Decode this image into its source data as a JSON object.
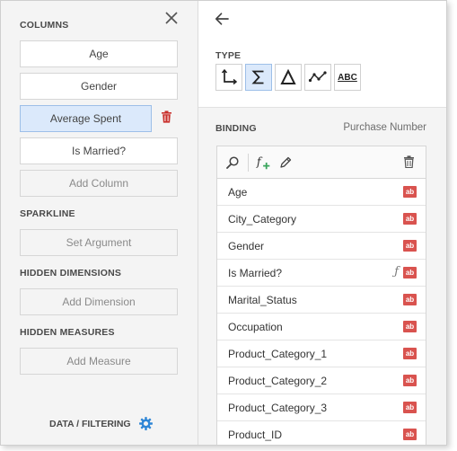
{
  "left": {
    "columns": {
      "title": "COLUMNS",
      "items": [
        {
          "label": "Age"
        },
        {
          "label": "Gender"
        },
        {
          "label": "Average Spent"
        },
        {
          "label": "Is Married?"
        }
      ],
      "add_label": "Add Column"
    },
    "sparkline": {
      "title": "SPARKLINE",
      "button": "Set Argument"
    },
    "hidden_dimensions": {
      "title": "HIDDEN DIMENSIONS",
      "button": "Add Dimension"
    },
    "hidden_measures": {
      "title": "HIDDEN MEASURES",
      "button": "Add Measure"
    },
    "data_filtering": "DATA / FILTERING"
  },
  "right": {
    "type_title": "TYPE",
    "type_buttons": [
      "dimension",
      "measure",
      "delta",
      "sparkline",
      "text"
    ],
    "type_selected": "measure",
    "type_text_glyph": "ABC",
    "binding_title": "BINDING",
    "binding_value": "Purchase Number",
    "fields": [
      {
        "name": "Age",
        "badge": "ab"
      },
      {
        "name": "City_Category",
        "badge": "ab"
      },
      {
        "name": "Gender",
        "badge": "ab"
      },
      {
        "name": "Is Married?",
        "badge": "ab",
        "calculated": true
      },
      {
        "name": "Marital_Status",
        "badge": "ab"
      },
      {
        "name": "Occupation",
        "badge": "ab"
      },
      {
        "name": "Product_Category_1",
        "badge": "ab"
      },
      {
        "name": "Product_Category_2",
        "badge": "ab"
      },
      {
        "name": "Product_Category_3",
        "badge": "ab"
      },
      {
        "name": "Product_ID",
        "badge": "ab"
      }
    ]
  },
  "colors": {
    "accent": "#2f86d6",
    "selected_bg": "#dbe9fb",
    "badge_red": "#d9534f",
    "trash_red": "#c9302c",
    "add_green": "#3aa55d"
  }
}
